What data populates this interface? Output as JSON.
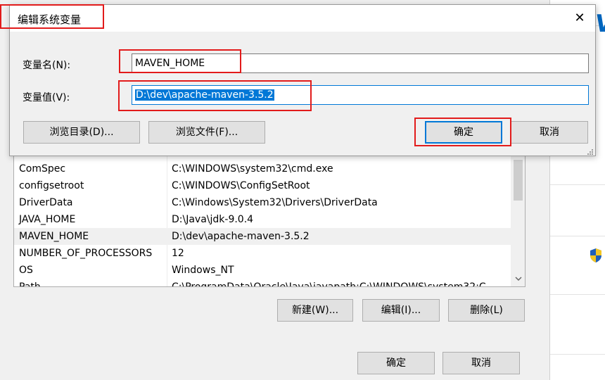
{
  "dialog": {
    "title": "编辑系统变量",
    "close_glyph": "✕",
    "name_label": "变量名(N):",
    "name_value": "MAVEN_HOME",
    "value_label": "变量值(V):",
    "value_value": "D:\\dev\\apache-maven-3.5.2",
    "browse_dir_label": "浏览目录(D)...",
    "browse_file_label": "浏览文件(F)...",
    "ok_label": "确定",
    "cancel_label": "取消"
  },
  "system_variables": {
    "rows": [
      {
        "name": "ComSpec",
        "value": "C:\\WINDOWS\\system32\\cmd.exe"
      },
      {
        "name": "configsetroot",
        "value": "C:\\WINDOWS\\ConfigSetRoot"
      },
      {
        "name": "DriverData",
        "value": "C:\\Windows\\System32\\Drivers\\DriverData"
      },
      {
        "name": "JAVA_HOME",
        "value": "D:\\Java\\jdk-9.0.4"
      },
      {
        "name": "MAVEN_HOME",
        "value": "D:\\dev\\apache-maven-3.5.2"
      },
      {
        "name": "NUMBER_OF_PROCESSORS",
        "value": "12"
      },
      {
        "name": "OS",
        "value": "Windows_NT"
      },
      {
        "name": "Path",
        "value": "C:\\ProgramData\\Oracle\\Java\\javapath;C:\\WINDOWS\\system32;C"
      }
    ],
    "selected_row": "MAVEN_HOME",
    "new_label": "新建(W)...",
    "edit_label": "编辑(I)...",
    "delete_label": "删除(L)"
  },
  "footer": {
    "ok_label": "确定",
    "cancel_label": "取消"
  },
  "icons": {
    "close": "close-icon",
    "scroll_down": "chevron-down-icon",
    "shield": "uac-shield-icon"
  },
  "colors": {
    "accent": "#0078d7",
    "annotation": "#e21b1b",
    "window_bg": "#f0f0f0"
  }
}
